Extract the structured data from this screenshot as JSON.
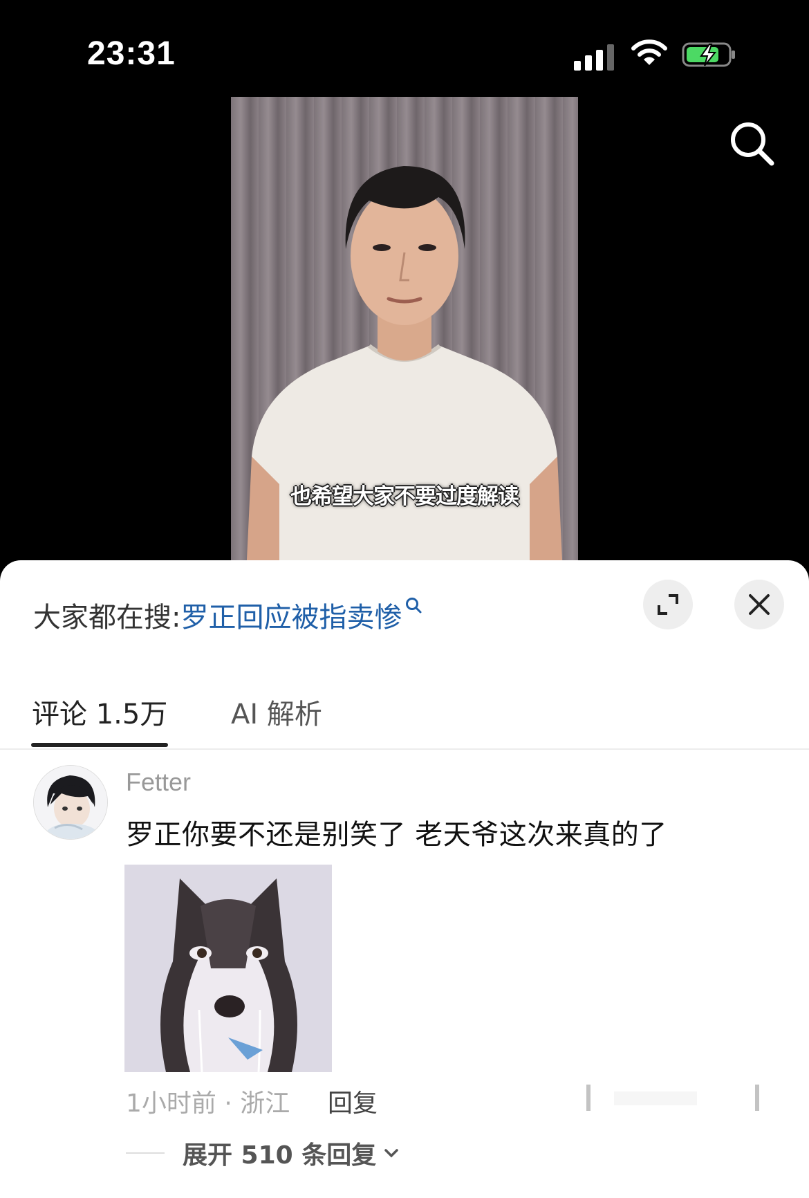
{
  "status_bar": {
    "time": "23:31"
  },
  "video": {
    "subtitle": "也希望大家不要过度解读"
  },
  "sheet": {
    "hot_search_prefix": "大家都在搜:",
    "hot_search_term": "罗正回应被指卖惨",
    "tabs": [
      {
        "label": "评论 1.5万"
      },
      {
        "label": "AI 解析"
      }
    ]
  },
  "comment": {
    "username": "Fetter",
    "text": "罗正你要不还是别笑了 老天爷这次来真的了",
    "meta": "1小时前 · 浙江",
    "reply_label": "回复",
    "expand_label": "展开 510 条回复"
  },
  "colors": {
    "link": "#1f5fa8",
    "sheet_bg": "#ffffff",
    "battery": "#4cd964"
  },
  "icons": [
    "search-icon",
    "expand-icon",
    "close-icon",
    "chevron-down-icon",
    "battery-charging-icon",
    "wifi-icon",
    "signal-icon"
  ]
}
